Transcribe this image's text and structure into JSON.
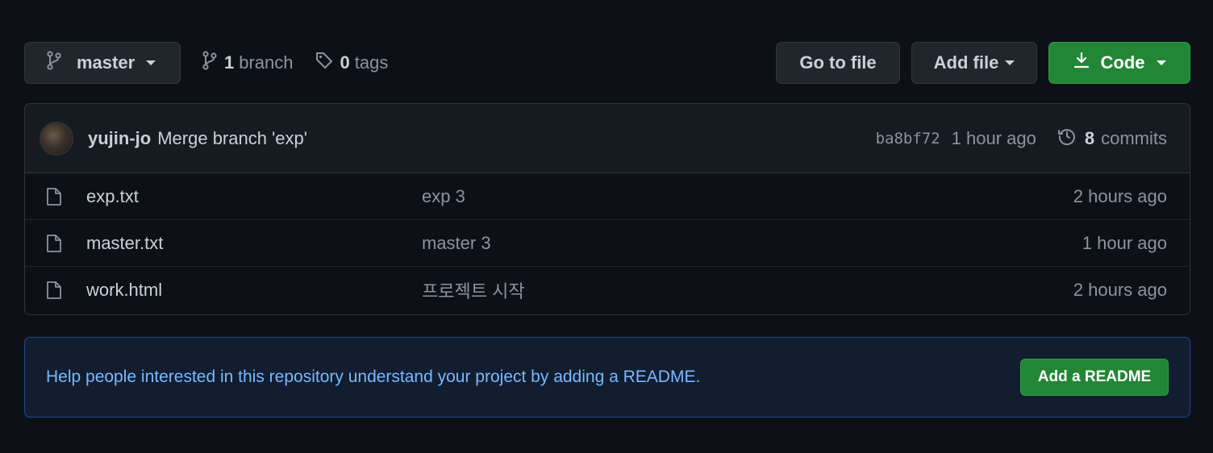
{
  "toolbar": {
    "branch_selector": "master",
    "branches_count": "1",
    "branches_label": "branch",
    "tags_count": "0",
    "tags_label": "tags",
    "goto_file": "Go to file",
    "add_file": "Add file",
    "code": "Code"
  },
  "latest_commit": {
    "author": "yujin-jo",
    "message": "Merge branch 'exp'",
    "sha": "ba8bf72",
    "time": "1 hour ago",
    "commits_count": "8",
    "commits_label": "commits"
  },
  "files": [
    {
      "name": "exp.txt",
      "message": "exp 3",
      "time": "2 hours ago"
    },
    {
      "name": "master.txt",
      "message": "master 3",
      "time": "1 hour ago"
    },
    {
      "name": "work.html",
      "message": "프로젝트 시작",
      "time": "2 hours ago"
    }
  ],
  "readme": {
    "text": "Help people interested in this repository understand your project by adding a README.",
    "button": "Add a README"
  },
  "colors": {
    "background": "#0d1117",
    "primary_button": "#238636",
    "link_blue": "#79b8ff"
  }
}
